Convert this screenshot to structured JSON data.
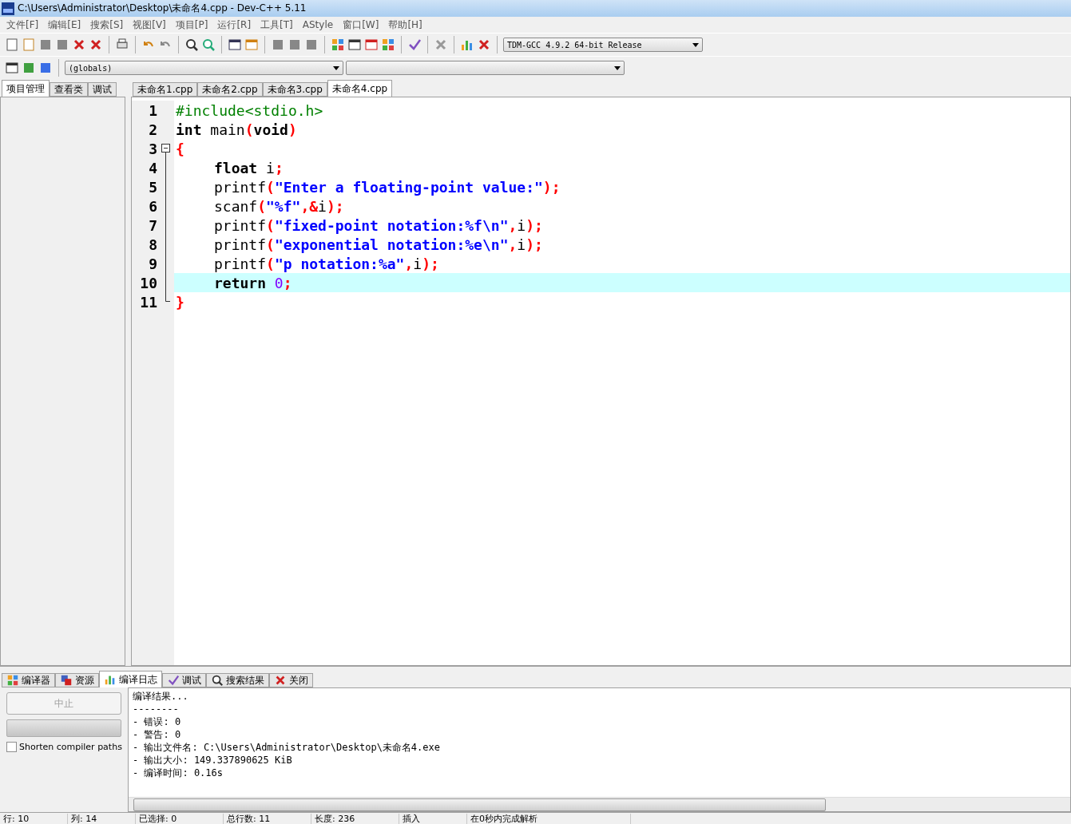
{
  "window": {
    "title": "C:\\Users\\Administrator\\Desktop\\未命名4.cpp - Dev-C++ 5.11"
  },
  "menu": [
    "文件[F]",
    "编辑[E]",
    "搜索[S]",
    "视图[V]",
    "项目[P]",
    "运行[R]",
    "工具[T]",
    "AStyle",
    "窗口[W]",
    "帮助[H]"
  ],
  "compiler_select": {
    "value": "TDM-GCC 4.9.2 64-bit Release"
  },
  "scope_select": {
    "value": "(globals)"
  },
  "left_tabs": [
    {
      "label": "项目管理",
      "selected": true
    },
    {
      "label": "查看类",
      "selected": false
    },
    {
      "label": "调试",
      "selected": false
    }
  ],
  "file_tabs": [
    {
      "label": "未命名1.cpp",
      "selected": false
    },
    {
      "label": "未命名2.cpp",
      "selected": false
    },
    {
      "label": "未命名3.cpp",
      "selected": false
    },
    {
      "label": "未命名4.cpp",
      "selected": true
    }
  ],
  "editor": {
    "lines": [
      {
        "number": "1",
        "indented": false,
        "current": false,
        "tokens": [
          {
            "kind": "pre",
            "text": "#include<stdio.h>"
          }
        ]
      },
      {
        "number": "2",
        "indented": false,
        "current": false,
        "tokens": [
          {
            "kind": "kw",
            "text": "int"
          },
          {
            "kind": "plain",
            "text": " main"
          },
          {
            "kind": "sym",
            "text": "("
          },
          {
            "kind": "kw",
            "text": "void"
          },
          {
            "kind": "sym",
            "text": ")"
          }
        ]
      },
      {
        "number": "3",
        "indented": false,
        "current": false,
        "kind": "fold_start",
        "tokens": [
          {
            "kind": "sym",
            "text": "{"
          }
        ]
      },
      {
        "number": "4",
        "indented": true,
        "current": false,
        "kind": "fold_body",
        "tokens": [
          {
            "kind": "kw",
            "text": "float"
          },
          {
            "kind": "plain",
            "text": " i"
          },
          {
            "kind": "sym",
            "text": ";"
          }
        ]
      },
      {
        "number": "5",
        "indented": true,
        "current": false,
        "kind": "fold_body",
        "tokens": [
          {
            "kind": "plain",
            "text": "printf"
          },
          {
            "kind": "sym",
            "text": "("
          },
          {
            "kind": "str",
            "text": "\"Enter a floating-point value:\""
          },
          {
            "kind": "sym",
            "text": ");"
          }
        ]
      },
      {
        "number": "6",
        "indented": true,
        "current": false,
        "kind": "fold_body",
        "tokens": [
          {
            "kind": "plain",
            "text": "scanf"
          },
          {
            "kind": "sym",
            "text": "("
          },
          {
            "kind": "str",
            "text": "\"%f\""
          },
          {
            "kind": "sym",
            "text": ",&"
          },
          {
            "kind": "plain",
            "text": "i"
          },
          {
            "kind": "sym",
            "text": ");"
          }
        ]
      },
      {
        "number": "7",
        "indented": true,
        "current": false,
        "kind": "fold_body",
        "tokens": [
          {
            "kind": "plain",
            "text": "printf"
          },
          {
            "kind": "sym",
            "text": "("
          },
          {
            "kind": "str",
            "text": "\"fixed-point notation:%f\\n\""
          },
          {
            "kind": "sym",
            "text": ","
          },
          {
            "kind": "plain",
            "text": "i"
          },
          {
            "kind": "sym",
            "text": ");"
          }
        ]
      },
      {
        "number": "8",
        "indented": true,
        "current": false,
        "kind": "fold_body",
        "tokens": [
          {
            "kind": "plain",
            "text": "printf"
          },
          {
            "kind": "sym",
            "text": "("
          },
          {
            "kind": "str",
            "text": "\"exponential notation:%e\\n\""
          },
          {
            "kind": "sym",
            "text": ","
          },
          {
            "kind": "plain",
            "text": "i"
          },
          {
            "kind": "sym",
            "text": ");"
          }
        ]
      },
      {
        "number": "9",
        "indented": true,
        "current": false,
        "kind": "fold_body",
        "tokens": [
          {
            "kind": "plain",
            "text": "printf"
          },
          {
            "kind": "sym",
            "text": "("
          },
          {
            "kind": "str",
            "text": "\"p notation:%a\""
          },
          {
            "kind": "sym",
            "text": ","
          },
          {
            "kind": "plain",
            "text": "i"
          },
          {
            "kind": "sym",
            "text": ");"
          }
        ]
      },
      {
        "number": "10",
        "indented": true,
        "current": true,
        "kind": "fold_body",
        "tokens": [
          {
            "kind": "kw",
            "text": "return "
          },
          {
            "kind": "num",
            "text": "0"
          },
          {
            "kind": "sym",
            "text": ";"
          }
        ]
      },
      {
        "number": "11",
        "indented": false,
        "current": false,
        "kind": "fold_end",
        "tokens": [
          {
            "kind": "sym",
            "text": "}"
          }
        ]
      }
    ]
  },
  "bottom_tabs": [
    {
      "label": "编译器",
      "selected": false
    },
    {
      "label": "资源",
      "selected": false
    },
    {
      "label": "编译日志",
      "selected": true
    },
    {
      "label": "调试",
      "selected": false
    },
    {
      "label": "搜索结果",
      "selected": false
    },
    {
      "label": "关闭",
      "selected": false
    }
  ],
  "progress": {
    "level": 0
  },
  "abort_button": {
    "label": "中止",
    "disabled": true
  },
  "shorten_paths": {
    "label": "Shorten compiler paths",
    "checked": false
  },
  "log": [
    "编译结果...",
    "--------",
    "- 错误: 0",
    "- 警告: 0",
    "- 输出文件名: C:\\Users\\Administrator\\Desktop\\未命名4.exe",
    "- 输出大小: 149.337890625 KiB",
    "- 编译时间: 0.16s"
  ],
  "status_bar": [
    "行: 10",
    "列: 14",
    "已选择: 0",
    "总行数: 11",
    "长度: 236",
    "插入",
    "在0秒内完成解析"
  ]
}
